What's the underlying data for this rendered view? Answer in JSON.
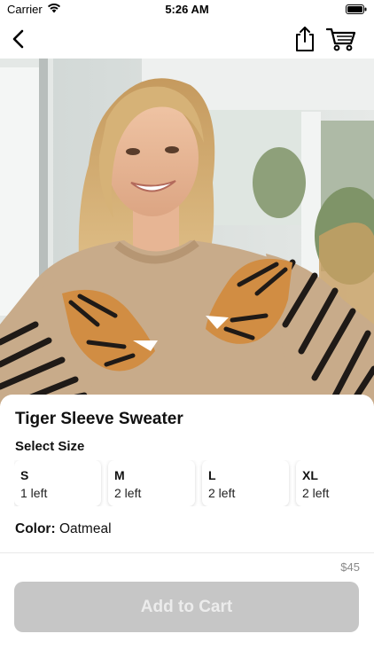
{
  "status_bar": {
    "carrier": "Carrier",
    "time": "5:26 AM"
  },
  "nav_bar": {
    "back_icon": "chevron-left-icon",
    "share_icon": "share-icon",
    "cart_icon": "cart-icon"
  },
  "product": {
    "title": "Tiger Sleeve Sweater",
    "select_size_label": "Select Size",
    "sizes": [
      {
        "size": "S",
        "stock": "1 left"
      },
      {
        "size": "M",
        "stock": "2 left"
      },
      {
        "size": "L",
        "stock": "2 left"
      },
      {
        "size": "XL",
        "stock": "2 left"
      }
    ],
    "color_label": "Color:",
    "color_value": " Oatmeal",
    "price": "$45"
  },
  "cta": {
    "add_to_cart_label": "Add to Cart"
  },
  "colors": {
    "disabled_button": "#c6c6c6",
    "sweater": "#c8ab8a",
    "stripe": "#1f1a17"
  }
}
